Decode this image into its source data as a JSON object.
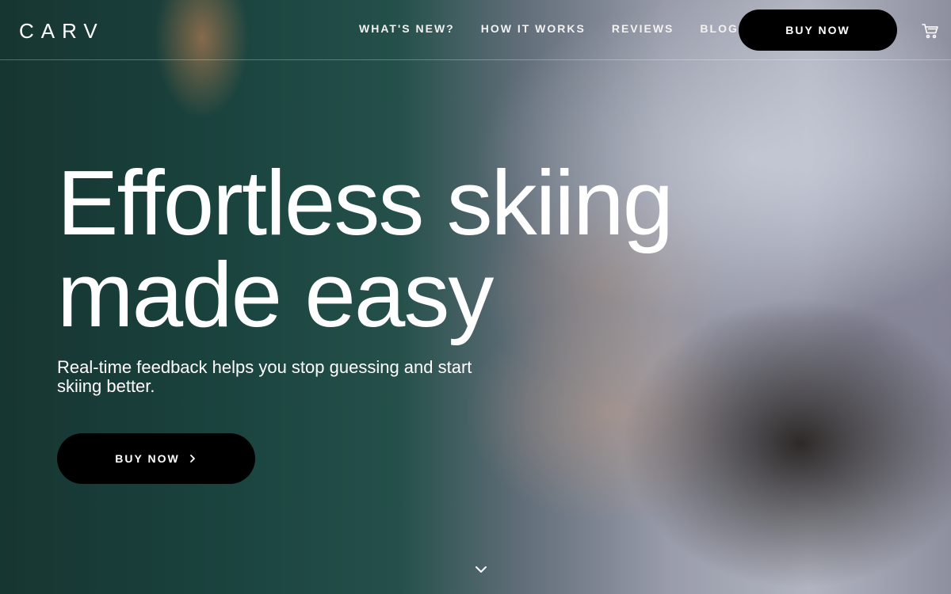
{
  "brand": {
    "logo": "CARV"
  },
  "nav": {
    "links": [
      "WHAT'S NEW?",
      "HOW IT WORKS",
      "REVIEWS",
      "BLOG"
    ],
    "buy_label": "BUY NOW",
    "cart_icon": "cart-icon"
  },
  "hero": {
    "headline_line1": "Effortless skiing",
    "headline_line2": "made easy",
    "subtitle": "Real-time feedback helps you stop guessing and start skiing better.",
    "cta_label": "BUY NOW",
    "cta_icon": "chevron-right-icon",
    "scroll_icon": "chevron-down-icon"
  },
  "colors": {
    "button_bg": "#000000",
    "text": "#ffffff"
  }
}
